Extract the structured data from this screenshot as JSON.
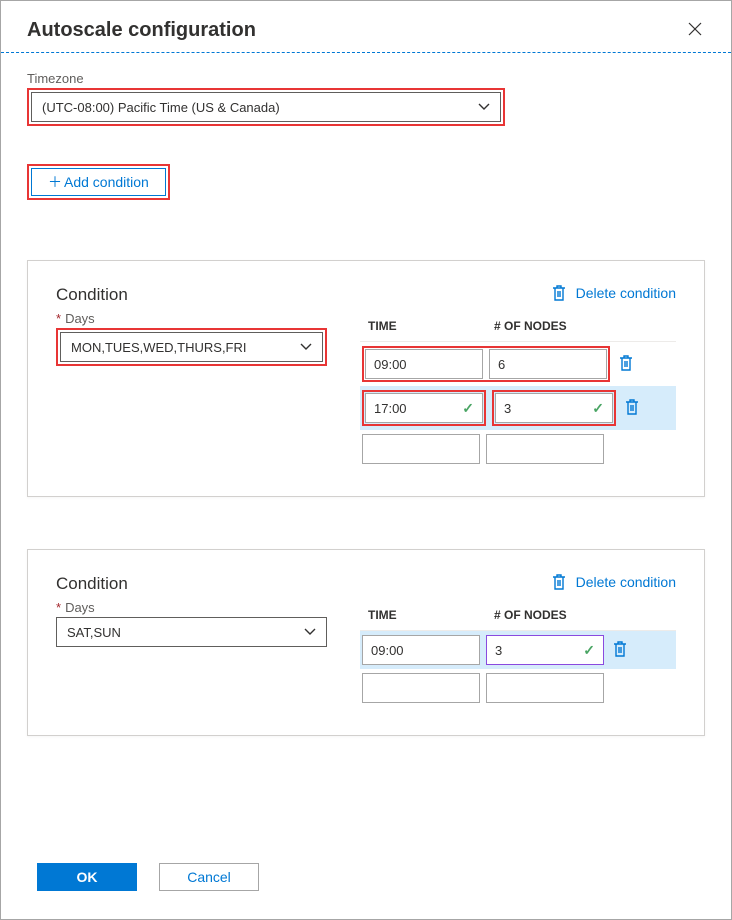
{
  "title": "Autoscale configuration",
  "timezone": {
    "label": "Timezone",
    "value": "(UTC-08:00) Pacific Time (US & Canada)"
  },
  "addCondition": {
    "label": "Add condition"
  },
  "columns": {
    "time": "TIME",
    "nodes": "# OF NODES"
  },
  "deleteLabel": "Delete condition",
  "conditionLabel": "Condition",
  "daysLabel": "Days",
  "conditions": [
    {
      "days": "MON,TUES,WED,THURS,FRI",
      "rows": [
        {
          "time": "09:00",
          "nodes": "6"
        },
        {
          "time": "17:00",
          "nodes": "3"
        }
      ]
    },
    {
      "days": "SAT,SUN",
      "rows": [
        {
          "time": "09:00",
          "nodes": "3"
        }
      ]
    }
  ],
  "buttons": {
    "ok": "OK",
    "cancel": "Cancel"
  }
}
